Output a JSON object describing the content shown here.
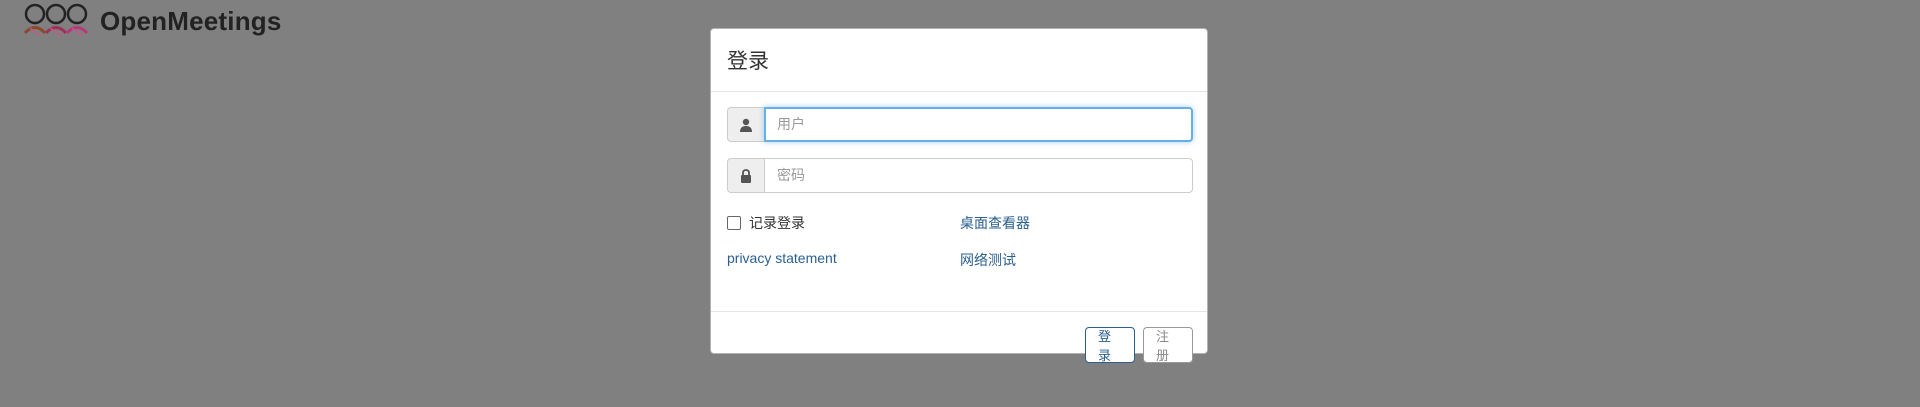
{
  "app": {
    "title": "OpenMeetings",
    "logo_icon": "people-logo-icon"
  },
  "login_dialog": {
    "title": "登录",
    "username": {
      "icon": "user-icon",
      "placeholder": "用户",
      "value": ""
    },
    "password": {
      "icon": "lock-icon",
      "placeholder": "密码",
      "value": ""
    },
    "remember_label": "记录登录",
    "remember_checked": false,
    "desktop_viewer_link": "桌面查看器",
    "privacy_link": "privacy statement",
    "network_test_link": "网络测试",
    "login_button": "登录",
    "register_button": "注册"
  },
  "colors": {
    "background": "#808080",
    "link": "#2a5f8f",
    "focus": "#66afe9"
  }
}
